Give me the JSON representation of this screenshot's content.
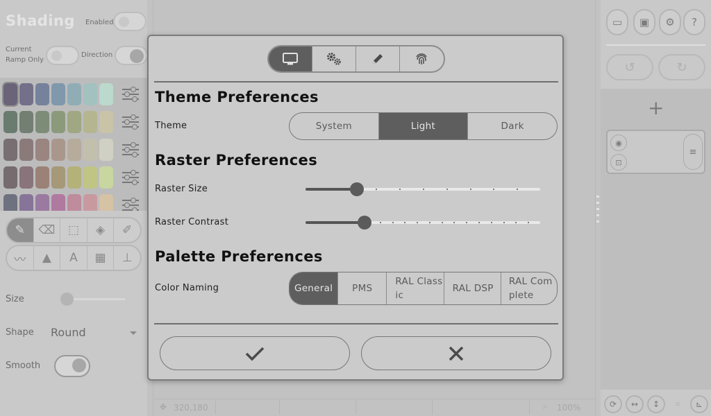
{
  "left_panel": {
    "title": "Shading",
    "enabled_label": "Enabled",
    "current_ramp_label_1": "Current",
    "current_ramp_label_2": "Ramp Only",
    "direction_label": "Direction",
    "size_label": "Size",
    "shape_label": "Shape",
    "shape_value": "Round",
    "smooth_label": "Smooth",
    "palette_rows": [
      [
        "#6b6478",
        "#74708a",
        "#76819c",
        "#7f98ab",
        "#90adb6",
        "#a2c2c0",
        "#bbd9cc"
      ],
      [
        "#6a7b70",
        "#727f72",
        "#7d8c77",
        "#8c9a7c",
        "#9fa783",
        "#b5b690",
        "#c9c3a8"
      ],
      [
        "#786f73",
        "#8b7a7a",
        "#9a8581",
        "#aa978c",
        "#b7ab9b",
        "#c3bfad",
        "#d0d0c4"
      ],
      [
        "#766b6f",
        "#88747a",
        "#9b8277",
        "#a69979",
        "#b4b179",
        "#c0c583",
        "#c8d6a0"
      ],
      [
        "#6e7280",
        "#867598",
        "#9a7aa0",
        "#b079a0",
        "#be8c9c",
        "#c89aa0",
        "#d6c2a4"
      ]
    ]
  },
  "dialog": {
    "tabs": [
      {
        "icon": "monitor-icon",
        "active": true
      },
      {
        "icon": "gears-icon",
        "active": false
      },
      {
        "icon": "pencil-icon",
        "active": false
      },
      {
        "icon": "fingerprint-icon",
        "active": false
      }
    ],
    "theme_heading": "Theme Preferences",
    "theme_label": "Theme",
    "theme_options": [
      "System",
      "Light",
      "Dark"
    ],
    "theme_selected": "Light",
    "raster_heading": "Raster Preferences",
    "raster_size_label": "Raster Size",
    "raster_size_value": 0.22,
    "raster_contrast_label": "Raster Contrast",
    "raster_contrast_value": 0.25,
    "palette_heading": "Palette Preferences",
    "color_naming_label": "Color Naming",
    "color_naming_options": [
      "General",
      "PMS",
      "RAL Classic",
      "RAL DSP",
      "RAL Complete"
    ],
    "color_naming_selected": "General",
    "confirm_icon": "checkmark-icon",
    "cancel_icon": "close-icon"
  },
  "status_bar": {
    "cursor_position": "320,180",
    "zoom": "100%"
  }
}
